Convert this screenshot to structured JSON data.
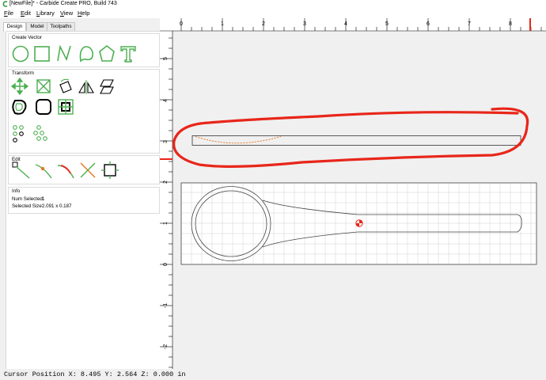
{
  "window": {
    "title": "[NewFile]* - Carbide Create PRO, Build 743"
  },
  "menu": [
    "File",
    "Edit",
    "Library",
    "View",
    "Help"
  ],
  "tabs": [
    "Design",
    "Model",
    "Toolpaths"
  ],
  "panels": {
    "create_vector": {
      "title": "Create Vector",
      "tools": [
        "circle-icon",
        "rectangle-icon",
        "polyline-icon",
        "curve-icon",
        "polygon-icon",
        "text-icon"
      ]
    },
    "transform": {
      "title": "Transform",
      "tools": [
        "move-icon",
        "scale-icon",
        "rotate-icon",
        "mirror-icon",
        "shear-icon",
        "offset-icon",
        "fillet-icon",
        "boolean-icon",
        "circular-array-icon",
        "grid-array-icon"
      ]
    },
    "edit": {
      "title": "Edit",
      "tools": [
        "node-edit-icon",
        "add-node-icon",
        "smooth-icon",
        "trim-icon",
        "join-icon"
      ]
    },
    "info": {
      "title": "Info",
      "num_selected_label": "Num Selected:",
      "num_selected_value": "1",
      "selected_size_label": "Selected Size:",
      "selected_size_value": "2.091 x 0.187"
    }
  },
  "ruler": {
    "top_labels": [
      "0",
      "1",
      "2",
      "3",
      "4",
      "5",
      "6",
      "7",
      "8"
    ],
    "side_labels": [
      "5",
      "4",
      "3",
      "2",
      "1",
      "0",
      "-1",
      "-2"
    ]
  },
  "status": {
    "text": "Cursor Position X: 8.495 Y: 2.564 Z: 0.000 in"
  },
  "colors": {
    "vector_green": "#4caf50",
    "annotation_red": "#e8261a",
    "selection_orange": "#e87722",
    "grid": "#d0d0d0"
  }
}
